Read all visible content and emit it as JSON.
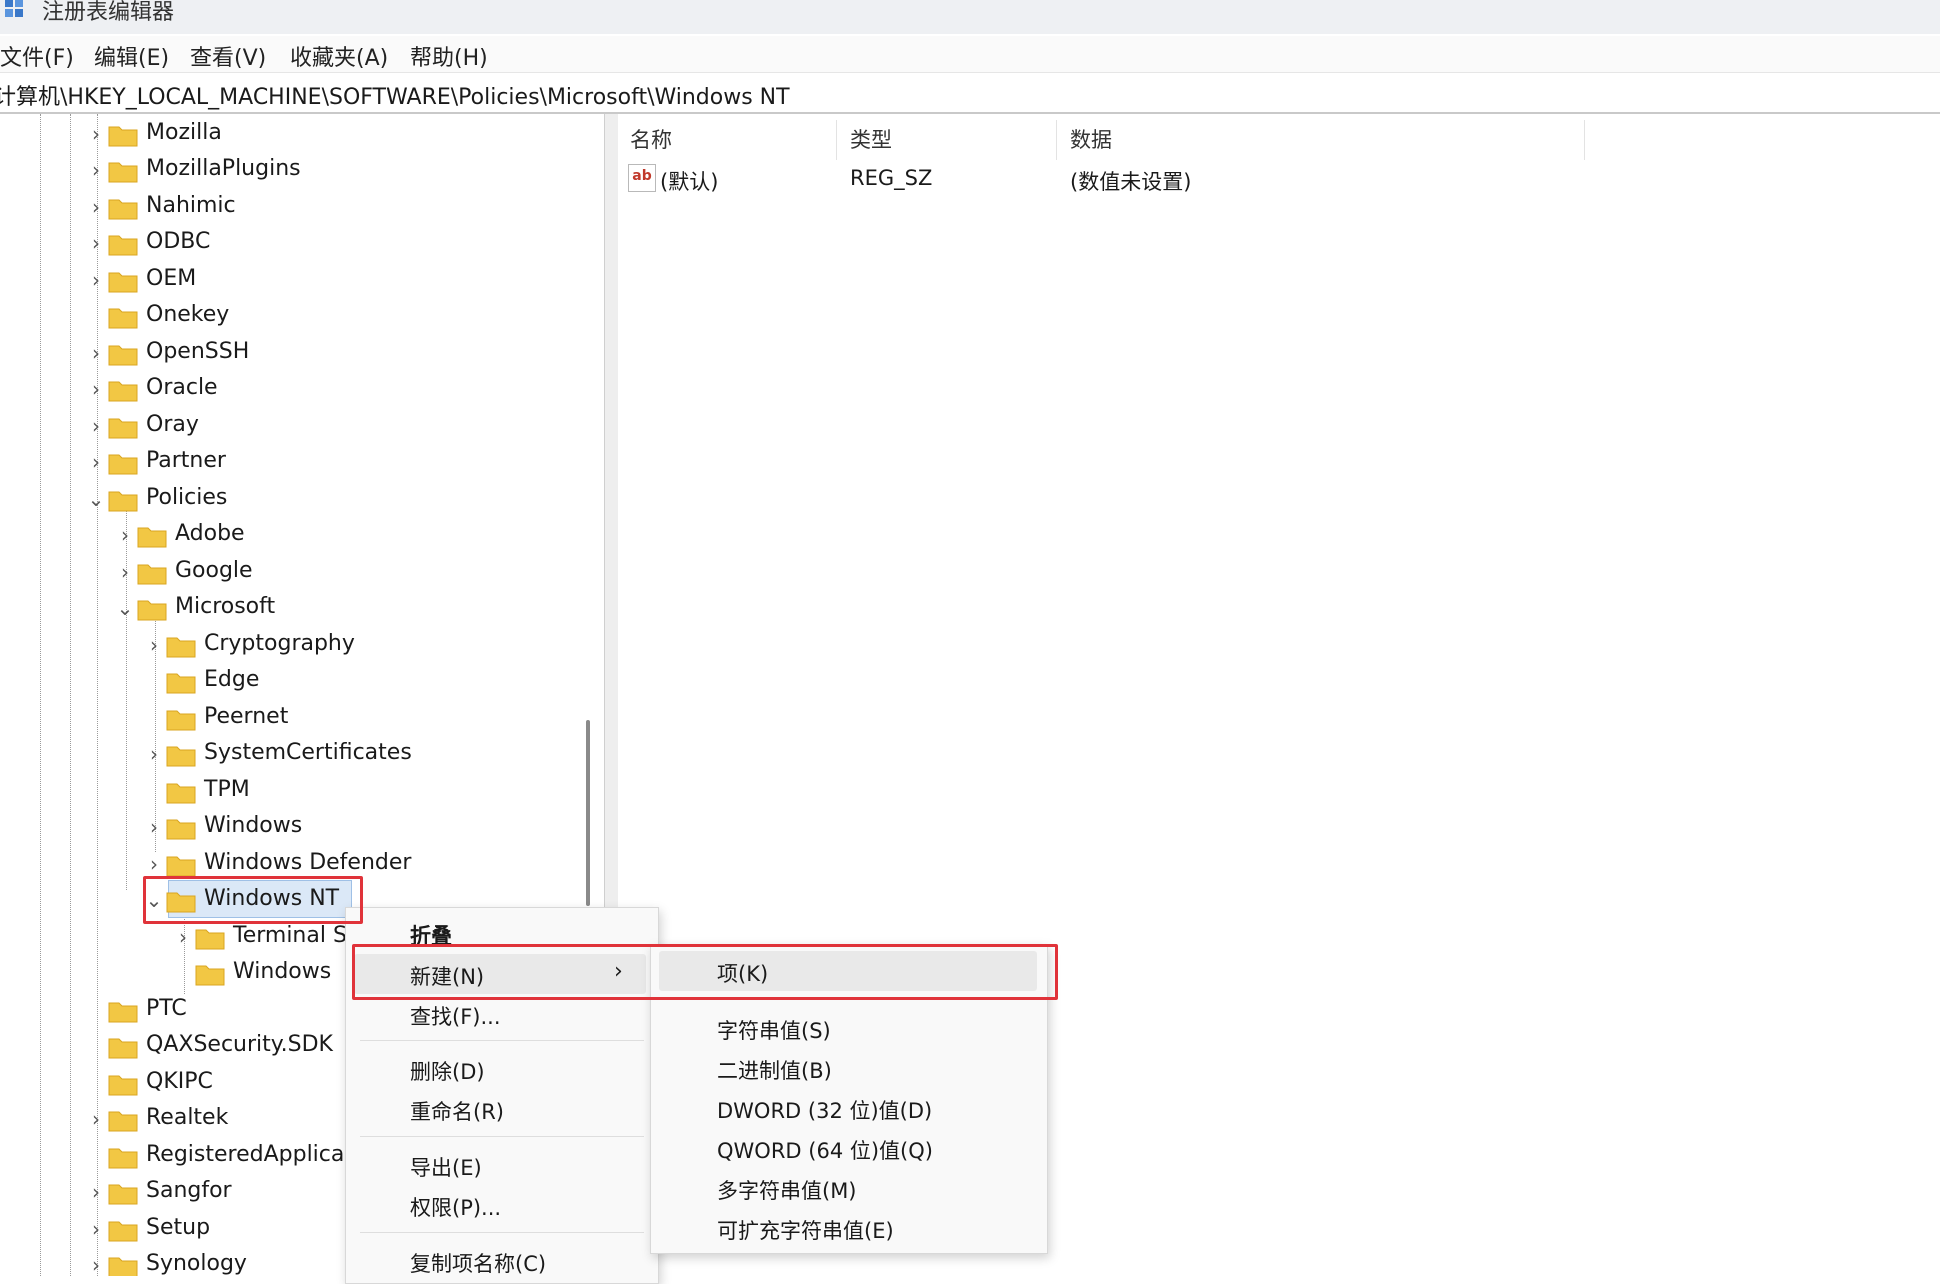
{
  "window": {
    "title": "注册表编辑器"
  },
  "menubar": [
    "文件(F)",
    "编辑(E)",
    "查看(V)",
    "收藏夹(A)",
    "帮助(H)"
  ],
  "address": "计算机\\HKEY_LOCAL_MACHINE\\SOFTWARE\\Policies\\Microsoft\\Windows NT",
  "tree": {
    "level0": {
      "mozilla": "Mozilla",
      "mozillaplugins": "MozillaPlugins",
      "nahimic": "Nahimic",
      "odbc": "ODBC",
      "oem": "OEM",
      "onekey": "Onekey",
      "openssh": "OpenSSH",
      "oracle": "Oracle",
      "oray": "Oray",
      "partner": "Partner",
      "policies": "Policies",
      "ptc": "PTC",
      "qaxsecurity": "QAXSecurity.SDK",
      "qkipc": "QKIPC",
      "realtek": "Realtek",
      "registeredapplica": "RegisteredApplica",
      "sangfor": "Sangfor",
      "setup": "Setup",
      "synology": "Synology"
    },
    "policies_children": {
      "adobe": "Adobe",
      "google": "Google",
      "microsoft": "Microsoft"
    },
    "microsoft_children": {
      "cryptography": "Cryptography",
      "edge": "Edge",
      "peernet": "Peernet",
      "systemcertificates": "SystemCertificates",
      "tpm": "TPM",
      "windows": "Windows",
      "windows_defender": "Windows Defender",
      "windows_nt": "Windows NT"
    },
    "windowsnt_children": {
      "terminal": "Terminal S",
      "windows": "Windows"
    }
  },
  "list": {
    "headers": {
      "name": "名称",
      "type": "类型",
      "data": "数据"
    },
    "rows": [
      {
        "name": "(默认)",
        "type": "REG_SZ",
        "data": "(数值未设置)",
        "icon": "ab"
      }
    ]
  },
  "context_menu": {
    "collapse": "折叠",
    "new": "新建(N)",
    "find": "查找(F)...",
    "delete": "删除(D)",
    "rename": "重命名(R)",
    "export": "导出(E)",
    "permissions": "权限(P)...",
    "copy_key_name": "复制项名称(C)"
  },
  "submenu_new": {
    "key": "项(K)",
    "string": "字符串值(S)",
    "binary": "二进制值(B)",
    "dword": "DWORD (32 位)值(D)",
    "qword": "QWORD (64 位)值(Q)",
    "multi_string": "多字符串值(M)",
    "expandable_string": "可扩充字符串值(E)"
  },
  "colors": {
    "folder": "#f2c744",
    "folder_edge": "#d9a520",
    "highlight_red": "#e0333a",
    "selection": "#dbe8f7"
  }
}
